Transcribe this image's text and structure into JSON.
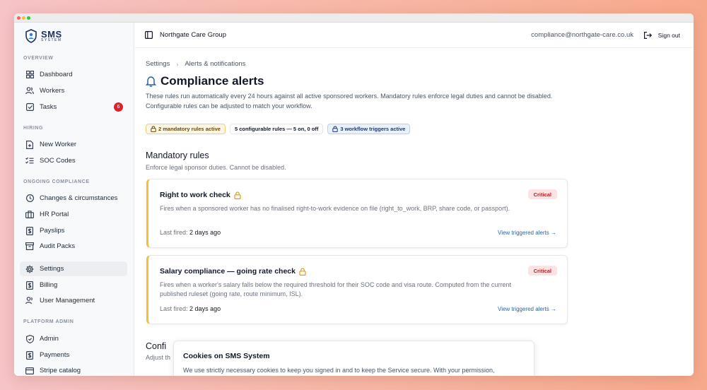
{
  "app": {
    "logo_text": "SMS",
    "logo_sub": "SYSTEM"
  },
  "sidebar": {
    "sections": [
      {
        "title": "OVERVIEW"
      },
      {
        "title": "HIRING"
      },
      {
        "title": "ONGOING COMPLIANCE"
      },
      {
        "title": "PLATFORM ADMIN"
      }
    ],
    "items": [
      {
        "label": "Dashboard",
        "icon": "grid-icon"
      },
      {
        "label": "Workers",
        "icon": "users-icon"
      },
      {
        "label": "Tasks",
        "icon": "checkbox-icon",
        "badge": "6"
      },
      {
        "label": "New Worker",
        "icon": "file-plus-icon"
      },
      {
        "label": "SOC Codes",
        "icon": "list-check-icon"
      },
      {
        "label": "Changes & circumstances",
        "icon": "clock-icon"
      },
      {
        "label": "HR Portal",
        "icon": "briefcase-icon"
      },
      {
        "label": "Payslips",
        "icon": "receipt-icon"
      },
      {
        "label": "Audit Packs",
        "icon": "archive-icon"
      },
      {
        "label": "Settings",
        "icon": "gear-icon",
        "active": true
      },
      {
        "label": "Billing",
        "icon": "receipt-icon"
      },
      {
        "label": "User Management",
        "icon": "user-icon"
      },
      {
        "label": "Admin",
        "icon": "shield-icon"
      },
      {
        "label": "Payments",
        "icon": "dollar-icon"
      },
      {
        "label": "Stripe catalog",
        "icon": "card-icon"
      }
    ]
  },
  "topbar": {
    "org": "Northgate Care Group",
    "email": "compliance@northgate-care.co.uk",
    "signout": "Sign out"
  },
  "breadcrumb": {
    "parent": "Settings",
    "current": "Alerts & notifications"
  },
  "page": {
    "title": "Compliance alerts",
    "description": "These rules run automatically every 24 hours against all active sponsored workers. Mandatory rules enforce legal duties and cannot be disabled. Configurable rules can be adjusted to match your workflow."
  },
  "pills": {
    "mandatory": "2 mandatory rules active",
    "configurable": "5 configurable rules — 5 on, 0 off",
    "workflow": "3 workflow triggers active"
  },
  "mandatory": {
    "heading": "Mandatory rules",
    "subheading": "Enforce legal sponsor duties. Cannot be disabled.",
    "rules": [
      {
        "title": "Right to work check",
        "severity": "Critical",
        "description": "Fires when a sponsored worker has no finalised right-to-work evidence on file (right_to_work, BRP, share code, or passport).",
        "last_fired_label": "Last fired:",
        "last_fired": "2 days ago",
        "link": "View triggered alerts →"
      },
      {
        "title": "Salary compliance — going rate check",
        "severity": "Critical",
        "description": "Fires when a worker's salary falls below the required threshold for their SOC code and visa route. Computed from the current published ruleset (going rate, route minimum, ISL).",
        "last_fired_label": "Last fired:",
        "last_fired": "2 days ago",
        "link": "View triggered alerts →"
      }
    ]
  },
  "configurable": {
    "heading_visible": "Confi",
    "sub_visible": "Adjust th"
  },
  "cookie": {
    "title": "Cookies on SMS System",
    "body": "We use strictly necessary cookies to keep you signed in and to keep the Service secure. With your permission,"
  },
  "colors": {
    "accent_amber": "#f2c230",
    "critical_bg": "#fde2e2",
    "critical_text": "#b4232c",
    "link": "#2563a8",
    "badge_red": "#e11d2e"
  }
}
